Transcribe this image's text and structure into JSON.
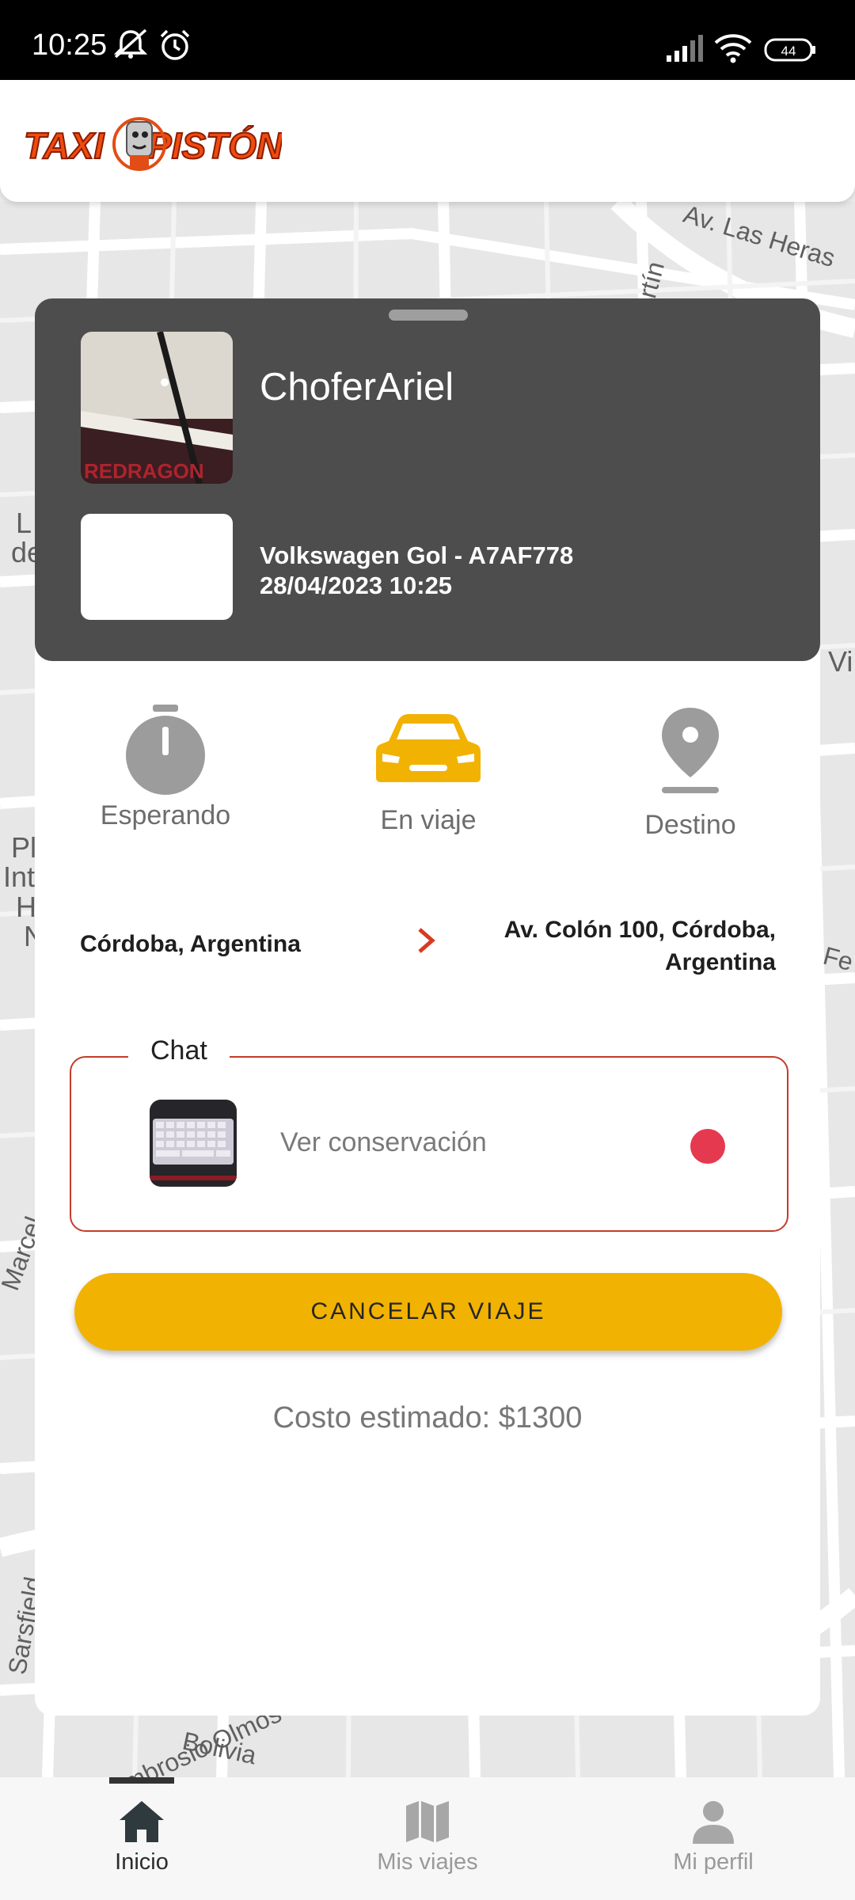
{
  "status_bar": {
    "time": "10:25",
    "battery": "44"
  },
  "app": {
    "brand": "TAXI PISTÓN"
  },
  "map": {
    "labels": [
      "Av. Las Heras",
      "rtín",
      "Av. Ambrosio Olmos",
      "Bolivia",
      "Sarsfield",
      "Vi",
      "Fe",
      "Marcel",
      "L",
      "de",
      "Pl",
      "Int",
      "H",
      "N"
    ]
  },
  "driver": {
    "name": "ChoferAriel",
    "vehicle": "Volkswagen Gol - A7AF778",
    "datetime": "28/04/2023 10:25"
  },
  "trip_steps": [
    {
      "label": "Esperando",
      "state": "done"
    },
    {
      "label": "En viaje",
      "state": "active",
      "color": "#f2b201"
    },
    {
      "label": "Destino",
      "state": "pending"
    }
  ],
  "route": {
    "origin": "Córdoba, Argentina",
    "destination_line1": "Av. Colón 100, Córdoba,",
    "destination_line2": "Argentina",
    "arrow_color": "#d83a22"
  },
  "chat": {
    "legend": "Chat",
    "preview": "Ver conservación",
    "unread_color": "#e53950"
  },
  "actions": {
    "cancel_label": "CANCELAR VIAJE"
  },
  "cost_text": "Costo estimado: $1300",
  "bottom_nav": [
    {
      "label": "Inicio",
      "icon": "home-icon",
      "active": true
    },
    {
      "label": "Mis viajes",
      "icon": "map-icon",
      "active": false
    },
    {
      "label": "Mi perfil",
      "icon": "person-icon",
      "active": false
    }
  ],
  "colors": {
    "accent": "#f2b201",
    "card": "#4d4d4d",
    "danger": "#c43c2a"
  }
}
